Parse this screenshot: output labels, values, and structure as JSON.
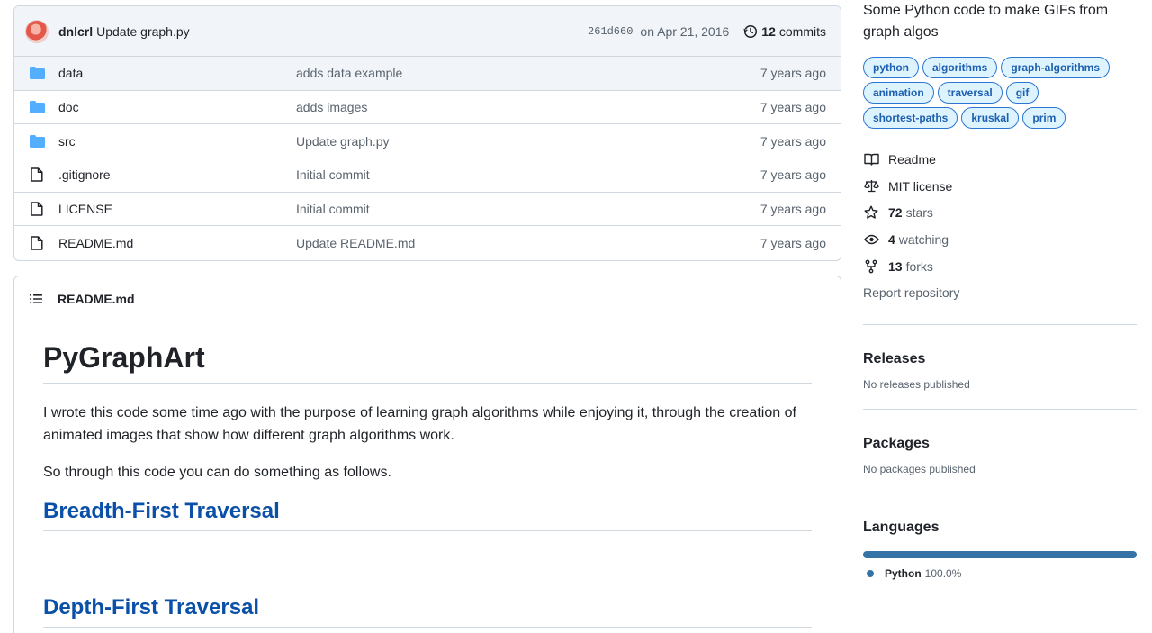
{
  "commit": {
    "author": "dnlcrl",
    "message": "Update graph.py",
    "sha": "261d660",
    "date": "on Apr 21, 2016",
    "commits_count": "12",
    "commits_label": "commits"
  },
  "files": [
    {
      "name": "data",
      "type": "folder",
      "message": "adds data example",
      "age": "7 years ago"
    },
    {
      "name": "doc",
      "type": "folder",
      "message": "adds images",
      "age": "7 years ago"
    },
    {
      "name": "src",
      "type": "folder",
      "message": "Update graph.py",
      "age": "7 years ago"
    },
    {
      "name": ".gitignore",
      "type": "file",
      "message": "Initial commit",
      "age": "7 years ago"
    },
    {
      "name": "LICENSE",
      "type": "file",
      "message": "Initial commit",
      "age": "7 years ago"
    },
    {
      "name": "README.md",
      "type": "file",
      "message": "Update README.md",
      "age": "7 years ago"
    }
  ],
  "readme": {
    "filename": "README.md",
    "title": "PyGraphArt",
    "para1": "I wrote this code some time ago with the purpose of learning graph algorithms while enjoying it, through the creation of animated images that show how different graph algorithms work.",
    "para2": "So through this code you can do something as follows.",
    "heading1": "Breadth-First Traversal",
    "heading2": "Depth-First Traversal"
  },
  "about": {
    "description": "Some Python code to make GIFs from graph algos",
    "topics": [
      "python",
      "algorithms",
      "graph-algorithms",
      "animation",
      "traversal",
      "gif",
      "shortest-paths",
      "kruskal",
      "prim"
    ],
    "readme_label": "Readme",
    "license_label": "MIT license",
    "stars_count": "72",
    "stars_label": "stars",
    "watching_count": "4",
    "watching_label": "watching",
    "forks_count": "13",
    "forks_label": "forks",
    "report_label": "Report repository"
  },
  "releases": {
    "title": "Releases",
    "subtitle": "No releases published"
  },
  "packages": {
    "title": "Packages",
    "subtitle": "No packages published"
  },
  "languages": {
    "title": "Languages",
    "items": [
      {
        "name": "Python",
        "percent": "100.0%",
        "color": "#3572a5"
      }
    ]
  },
  "colors": {
    "link": "#0a50a8",
    "folder": "#54aeff",
    "topic_bg": "#ddf4ff",
    "python": "#3572a5"
  }
}
